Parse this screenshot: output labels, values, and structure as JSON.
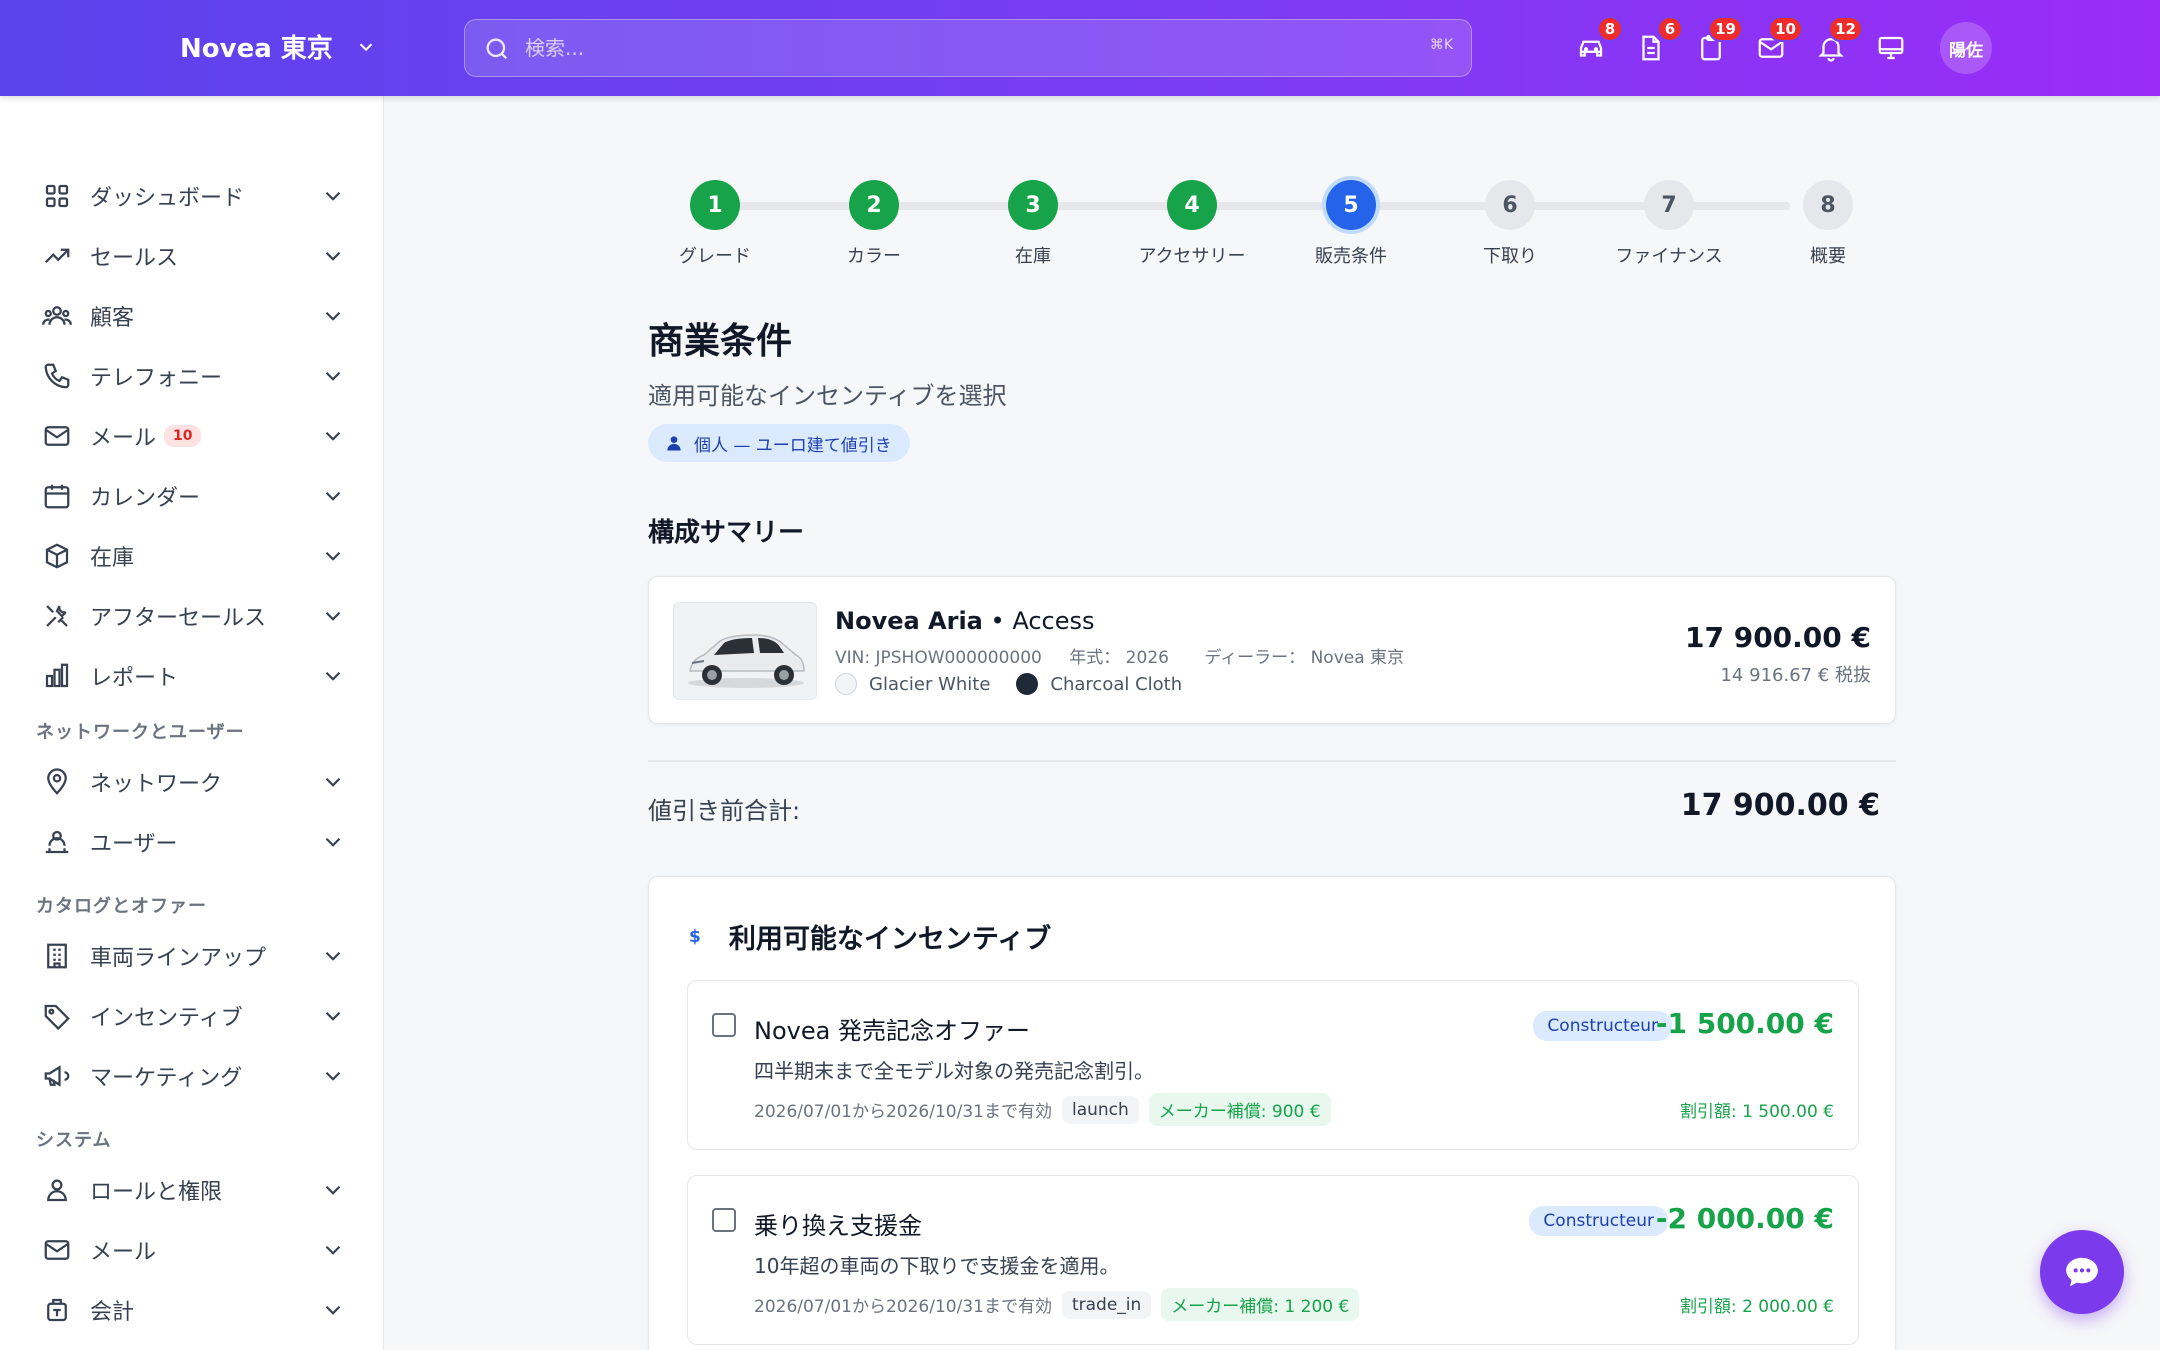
{
  "header": {
    "brand": "Novea 東京",
    "search_placeholder": "検索...",
    "search_shortcut": "⌘K",
    "icons": [
      {
        "name": "car-icon",
        "badge": "8"
      },
      {
        "name": "document-icon",
        "badge": "6"
      },
      {
        "name": "clipboard-icon",
        "badge": "19"
      },
      {
        "name": "mail-icon",
        "badge": "10"
      },
      {
        "name": "bell-icon",
        "badge": "12"
      },
      {
        "name": "monitor-icon",
        "badge": ""
      }
    ],
    "avatar": "陽佐"
  },
  "sidebar": {
    "items": [
      {
        "label": "ダッシュボード",
        "icon": "grid-icon"
      },
      {
        "label": "セールス",
        "icon": "trending-up-icon"
      },
      {
        "label": "顧客",
        "icon": "users-icon"
      },
      {
        "label": "テレフォニー",
        "icon": "phone-icon"
      },
      {
        "label": "メール",
        "icon": "mail-icon",
        "count": "10"
      },
      {
        "label": "カレンダー",
        "icon": "calendar-icon"
      },
      {
        "label": "在庫",
        "icon": "box-icon"
      },
      {
        "label": "アフターセールス",
        "icon": "tools-icon"
      },
      {
        "label": "レポート",
        "icon": "bar-chart-icon"
      }
    ],
    "section_network": "ネットワークとユーザー",
    "network_items": [
      {
        "label": "ネットワーク",
        "icon": "map-pin-icon"
      },
      {
        "label": "ユーザー",
        "icon": "user-network-icon"
      }
    ],
    "section_catalog": "カタログとオファー",
    "catalog_items": [
      {
        "label": "車両ラインアップ",
        "icon": "building-icon"
      },
      {
        "label": "インセンティブ",
        "icon": "tag-icon"
      },
      {
        "label": "マーケティング",
        "icon": "megaphone-icon"
      }
    ],
    "section_system": "システム",
    "system_items": [
      {
        "label": "ロールと権限",
        "icon": "user-icon"
      },
      {
        "label": "メール",
        "icon": "mail-icon"
      },
      {
        "label": "会計",
        "icon": "accounting-icon"
      }
    ]
  },
  "stepper": {
    "steps": [
      {
        "num": "1",
        "label": "グレード",
        "state": "done"
      },
      {
        "num": "2",
        "label": "カラー",
        "state": "done"
      },
      {
        "num": "3",
        "label": "在庫",
        "state": "done"
      },
      {
        "num": "4",
        "label": "アクセサリー",
        "state": "done"
      },
      {
        "num": "5",
        "label": "販売条件",
        "state": "active"
      },
      {
        "num": "6",
        "label": "下取り",
        "state": "todo"
      },
      {
        "num": "7",
        "label": "ファイナンス",
        "state": "todo"
      },
      {
        "num": "8",
        "label": "概要",
        "state": "todo"
      }
    ]
  },
  "page": {
    "title": "商業条件",
    "subtitle": "適用可能なインセンティブを選択",
    "customer_chip": "個人 — ユーロ建て値引き",
    "summary_title": "構成サマリー"
  },
  "summary": {
    "model": "Novea Aria",
    "separator": "•",
    "trim": "Access",
    "vin": "VIN: JPSHOW000000000",
    "year": "年式： 2026",
    "dealer": "ディーラー： Novea 東京",
    "exterior_color": "Glacier White",
    "exterior_hex": "#f3f4f6",
    "interior_color": "Charcoal Cloth",
    "interior_hex": "#1f2937",
    "price": "17 900.00 €",
    "price_ht": "14 916.67 € 税抜"
  },
  "subtotal": {
    "label": "値引き前合計:",
    "value": "17 900.00 €"
  },
  "incentives": {
    "title": "利用可能なインセンティブ",
    "icon": "$",
    "items": [
      {
        "title": "Novea 発売記念オファー",
        "description": "四半期末まで全モデル対象の発売記念割引。",
        "validity": "2026/07/01から2026/10/31まで有効",
        "code": "launch",
        "maker_share": "メーカー補償: 900 €",
        "type": "Constructeur",
        "amount": "-1 500.00 €",
        "discount": "割引額: 1 500.00 €",
        "checked": false
      },
      {
        "title": "乗り換え支援金",
        "description": "10年超の車両の下取りで支援金を適用。",
        "validity": "2026/07/01から2026/10/31まで有効",
        "code": "trade_in",
        "maker_share": "メーカー補償: 1 200 €",
        "type": "Constructeur",
        "amount": "-2 000.00 €",
        "discount": "割引額: 2 000.00 €",
        "checked": false
      }
    ]
  },
  "colors": {
    "header_start": "#5b43ec",
    "header_end": "#9b2cf7",
    "step_done": "#16a34a",
    "step_active": "#2563eb",
    "discount_green": "#16a34a",
    "badge_red": "#ef2b2b",
    "fab": "#7c3aed"
  }
}
